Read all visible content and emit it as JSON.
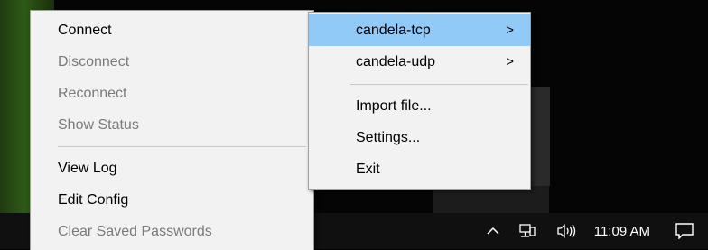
{
  "main_menu": {
    "items": [
      {
        "label": "Connect",
        "enabled": true
      },
      {
        "label": "Disconnect",
        "enabled": false
      },
      {
        "label": "Reconnect",
        "enabled": false
      },
      {
        "label": "Show Status",
        "enabled": false
      },
      {
        "label": "View Log",
        "enabled": true
      },
      {
        "label": "Edit Config",
        "enabled": true
      },
      {
        "label": "Clear Saved Passwords",
        "enabled": false
      }
    ]
  },
  "submenu": {
    "items": [
      {
        "label": "candela-tcp",
        "has_submenu": true,
        "highlighted": true
      },
      {
        "label": "candela-udp",
        "has_submenu": true,
        "highlighted": false
      },
      {
        "label": "Import file...",
        "has_submenu": false
      },
      {
        "label": "Settings...",
        "has_submenu": false
      },
      {
        "label": "Exit",
        "has_submenu": false
      }
    ],
    "arrow_glyph": ">"
  },
  "taskbar": {
    "chevron": "^",
    "network_icon": "network-icon",
    "volume_icon": "volume-icon",
    "volume_glyph": "ↆ))",
    "clock": "11:09 AM",
    "notification_icon": "notification-icon"
  },
  "colors": {
    "menu_bg": "#f2f2f2",
    "highlight": "#91c9f7",
    "disabled_text": "#7a7a7a",
    "taskbar_bg": "#101010"
  }
}
